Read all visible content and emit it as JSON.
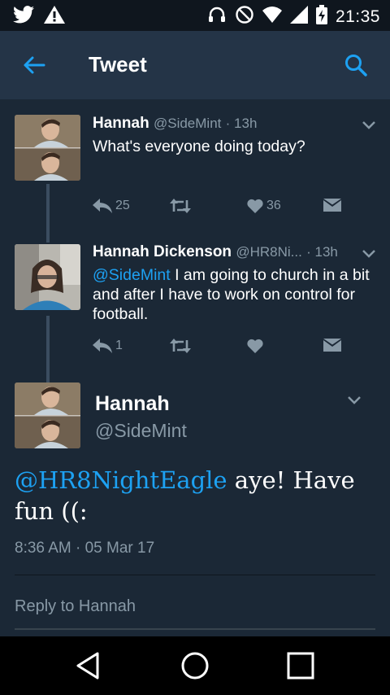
{
  "status_bar": {
    "time": "21:35",
    "icons": [
      "twitter-icon",
      "warning-icon",
      "headset-icon",
      "do-not-disturb-icon",
      "wifi-icon",
      "cell-signal-icon",
      "battery-charging-icon"
    ]
  },
  "app_bar": {
    "title": "Tweet",
    "back_icon": "arrow-left-icon",
    "search_icon": "search-icon"
  },
  "tweets": [
    {
      "name": "Hannah",
      "handle": "@SideMint",
      "time": "· 13h",
      "mention": "",
      "text": "What's everyone doing today?",
      "replies": "25",
      "retweets": "",
      "likes": "36"
    },
    {
      "name": "Hannah Dickenson",
      "handle": "@HR8Ni...",
      "time": "· 13h",
      "mention": "@SideMint",
      "text": " I am going to church in a bit and after I have to work on control for football.",
      "replies": "1",
      "retweets": "",
      "likes": ""
    }
  ],
  "main_tweet": {
    "name": "Hannah",
    "handle": "@SideMint",
    "mention": "@HR8NightEagle",
    "text": " aye! Have fun ((:",
    "timestamp": "8:36 AM · 05 Mar 17"
  },
  "reply": {
    "placeholder": "Reply to Hannah"
  },
  "colors": {
    "background": "#1b2836",
    "app_bar": "#243447",
    "accent": "#1da1f2",
    "muted_text": "#8899a6"
  }
}
